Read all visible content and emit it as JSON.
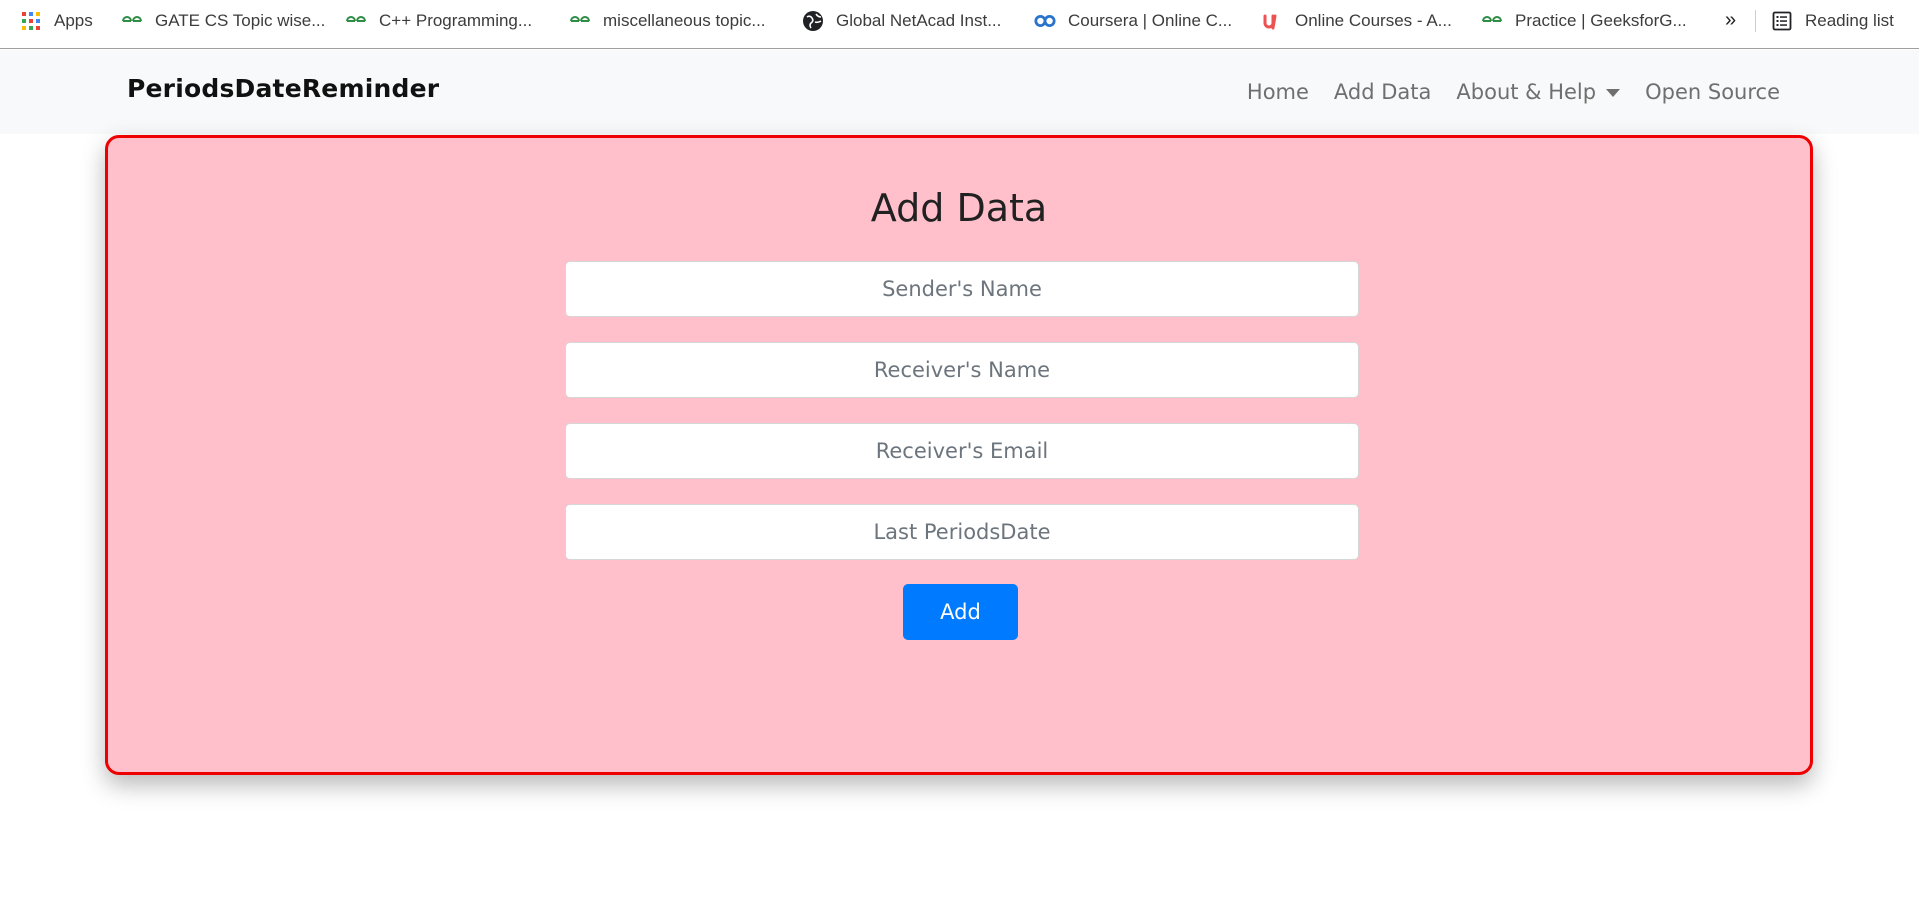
{
  "bookmarks": [
    {
      "label": "Apps",
      "icon": "apps-grid-icon"
    },
    {
      "label": "GATE CS Topic wise...",
      "icon": "geeksforgeeks-icon"
    },
    {
      "label": "C++ Programming...",
      "icon": "geeksforgeeks-icon"
    },
    {
      "label": "miscellaneous topic...",
      "icon": "geeksforgeeks-icon"
    },
    {
      "label": "Global NetAcad Inst...",
      "icon": "globe-icon"
    },
    {
      "label": "Coursera | Online C...",
      "icon": "coursera-icon"
    },
    {
      "label": "Online Courses - A...",
      "icon": "udemy-icon"
    },
    {
      "label": "Practice | GeeksforG...",
      "icon": "geeksforgeeks-icon"
    }
  ],
  "bookmarks_overflow": "»",
  "reading_list": {
    "label": "Reading list",
    "icon": "reading-list-icon"
  },
  "navbar": {
    "brand": "PeriodsDateReminder",
    "links": [
      {
        "label": "Home"
      },
      {
        "label": "Add Data"
      },
      {
        "label": "About & Help",
        "dropdown": true
      },
      {
        "label": "Open Source"
      }
    ]
  },
  "form": {
    "title": "Add Data",
    "fields": [
      {
        "placeholder": "Sender's Name",
        "value": ""
      },
      {
        "placeholder": "Receiver's Name",
        "value": ""
      },
      {
        "placeholder": "Receiver's Email",
        "value": ""
      },
      {
        "placeholder": "Last PeriodsDate",
        "value": ""
      }
    ],
    "submit_label": "Add"
  },
  "colors": {
    "card_background": "#ffc0cb",
    "card_border": "#ee0000",
    "button": "#007bff",
    "navbar_background": "#f8f9fa",
    "gfg_green": "#2f8d46"
  }
}
